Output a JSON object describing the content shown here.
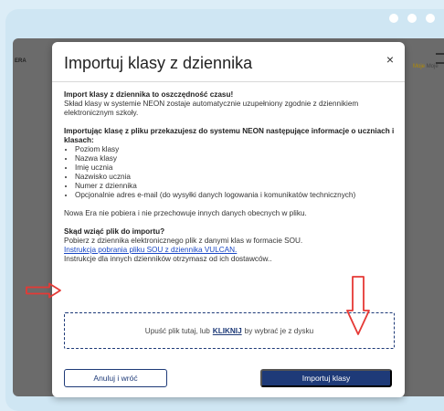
{
  "background": {
    "left_label": "ERA",
    "right_labels": [
      "Moje",
      "Moje"
    ]
  },
  "modal": {
    "title": "Importuj klasy z dziennika",
    "close_glyph": "×",
    "intro_heading": "Import klasy z dziennika to oszczędność czasu!",
    "intro_text": "Skład klasy w systemie NEON zostaje automatycznie uzupełniony zgodnie z dziennikiem elektronicznym szkoły.",
    "info_heading": "Importując klasę z pliku przekazujesz do systemu NEON następujące informacje o uczniach i klasach:",
    "info_items": [
      "Poziom klasy",
      "Nazwa klasy",
      "Imię ucznia",
      "Nazwisko ucznia",
      "Numer z dziennika",
      "Opcjonalnie adres e-mail (do wysyłki danych logowania i komunikatów technicznych)"
    ],
    "privacy_text": "Nowa Era nie pobiera i nie przechowuje innych danych obecnych w pliku.",
    "source_heading": "Skąd wziąć plik do importu?",
    "source_text": "Pobierz z dziennika elektronicznego plik z danymi klas w formacie SOU.",
    "source_link": "Instrukcja pobrania pliku SOU z dziennika VULCAN.",
    "source_other": "Instrukcje dla innych dzienników otrzymasz od ich dostawców..",
    "drop_zone": {
      "before": "Upuść plik tutaj, lub",
      "link": "KLIKNIJ",
      "after": "by wybrać je z dysku"
    },
    "cancel_label": "Anuluj i wróć",
    "import_label": "Importuj klasy"
  },
  "colors": {
    "primary": "#1e3a78",
    "link": "#1a47c4",
    "annotation": "#e53935",
    "overlay": "#6b6b6b",
    "page_bg": "#dcedf7"
  }
}
